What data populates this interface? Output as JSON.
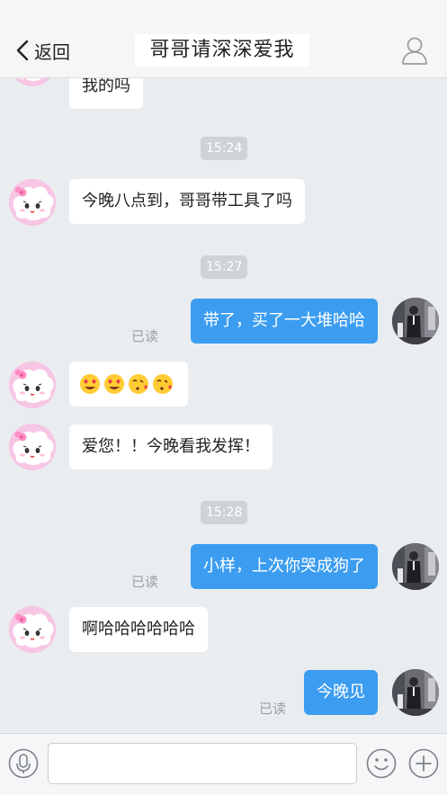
{
  "header": {
    "back_label": "返回",
    "title": "哥哥请深深爱我"
  },
  "messages": {
    "m0": "我的吗",
    "m1": "今晚八点到，哥哥带工具了吗",
    "m2": "带了，买了一大堆哈哈",
    "m3_emojis": [
      "heart-eyes",
      "heart-eyes",
      "kissing-heart",
      "kissing-heart"
    ],
    "m4": "爱您！！今晚看我发挥！",
    "m5": "小样，上次你哭成狗了",
    "m6": "啊哈哈哈哈哈哈",
    "m7": "今晚见"
  },
  "timestamps": {
    "t1": "15:24",
    "t2": "15:27",
    "t3": "15:28"
  },
  "read_label": "已读",
  "colors": {
    "outgoing_bubble": "#3c9df0",
    "incoming_bubble": "#ffffff",
    "background": "#eaedf0",
    "girl_avatar": "#f7c6e4"
  },
  "input_bar": {
    "placeholder": ""
  }
}
